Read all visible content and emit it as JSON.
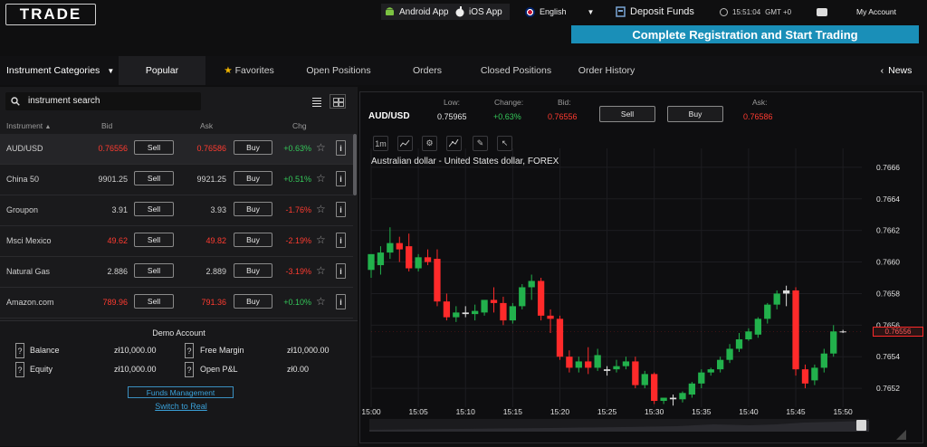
{
  "header": {
    "logo_text": "TRADE",
    "android_app": "Android App",
    "ios_app": "iOS App",
    "language": "English",
    "deposit": "Deposit Funds",
    "clock": "15:51:04",
    "timezone": "GMT +0",
    "account": "My Account",
    "register_btn": "Complete Registration and Start Trading"
  },
  "tabs": {
    "categories": "Instrument Categories",
    "popular": "Popular",
    "favorites": "Favorites",
    "open_positions": "Open Positions",
    "orders": "Orders",
    "closed_positions": "Closed Positions",
    "order_history": "Order History",
    "news": "News"
  },
  "search": {
    "value": "instrument search"
  },
  "columns": {
    "instrument": "Instrument",
    "bid": "Bid",
    "ask": "Ask",
    "chg": "Chg"
  },
  "instruments": [
    {
      "name": "AUD/USD",
      "bid": "0.76556",
      "ask": "0.76586",
      "chg": "+0.63%",
      "bid_color": "red",
      "ask_color": "red",
      "chg_color": "green"
    },
    {
      "name": "China 50",
      "bid": "9901.25",
      "ask": "9921.25",
      "chg": "+0.51%",
      "bid_color": "white",
      "ask_color": "white",
      "chg_color": "green"
    },
    {
      "name": "Groupon",
      "bid": "3.91",
      "ask": "3.93",
      "chg": "-1.76%",
      "bid_color": "white",
      "ask_color": "white",
      "chg_color": "red"
    },
    {
      "name": "Msci Mexico",
      "bid": "49.62",
      "ask": "49.82",
      "chg": "-2.19%",
      "bid_color": "red",
      "ask_color": "red",
      "chg_color": "red"
    },
    {
      "name": "Natural Gas",
      "bid": "2.886",
      "ask": "2.889",
      "chg": "-3.19%",
      "bid_color": "white",
      "ask_color": "white",
      "chg_color": "red"
    },
    {
      "name": "Amazon.com",
      "bid": "789.96",
      "ask": "791.36",
      "chg": "+0.10%",
      "bid_color": "red",
      "ask_color": "red",
      "chg_color": "green"
    }
  ],
  "buttons": {
    "sell": "Sell",
    "buy": "Buy"
  },
  "account": {
    "title": "Demo Account",
    "balance_label": "Balance",
    "balance": "zł10,000.00",
    "equity_label": "Equity",
    "equity": "zł10,000.00",
    "free_margin_label": "Free Margin",
    "free_margin": "zł10,000.00",
    "pnl_label": "Open P&L",
    "pnl": "zł0.00",
    "funds_btn": "Funds Management",
    "switch_link": "Switch to Real"
  },
  "quote": {
    "symbol": "AUD/USD",
    "low_label": "Low:",
    "low": "0.75965",
    "change_label": "Change:",
    "change": "+0.63%",
    "bid_label": "Bid:",
    "bid": "0.76556",
    "ask_label": "Ask:",
    "ask": "0.76586"
  },
  "chart_toolbar": {
    "interval": "1m"
  },
  "colors": {
    "up": "#22b14c",
    "down": "#ff2a2a",
    "accent": "#1a8fb8"
  },
  "chart_data": {
    "type": "candlestick",
    "title": "Australian dollar - United States dollar, FOREX",
    "x_ticks": [
      "15:00",
      "15:05",
      "15:10",
      "15:15",
      "15:20",
      "15:25",
      "15:30",
      "15:35",
      "15:40",
      "15:45",
      "15:50"
    ],
    "y_ticks": [
      "0.7666",
      "0.7664",
      "0.7662",
      "0.7660",
      "0.7658",
      "0.7656",
      "0.7654",
      "0.7652"
    ],
    "ylim": [
      0.76508,
      0.76672
    ],
    "xlim_minutes": [
      0,
      52
    ],
    "last_price": "0.76556",
    "candles": [
      {
        "t": 0,
        "o": 0.76595,
        "h": 0.76602,
        "c": 0.76605,
        "l": 0.7659
      },
      {
        "t": 1,
        "o": 0.76598,
        "h": 0.7661,
        "c": 0.76606,
        "l": 0.76592
      },
      {
        "t": 2,
        "o": 0.76606,
        "h": 0.76622,
        "c": 0.76612,
        "l": 0.76602
      },
      {
        "t": 3,
        "o": 0.76612,
        "h": 0.76616,
        "c": 0.76608,
        "l": 0.766
      },
      {
        "t": 4,
        "o": 0.7661,
        "h": 0.76618,
        "c": 0.76596,
        "l": 0.76594
      },
      {
        "t": 5,
        "o": 0.76596,
        "h": 0.76605,
        "c": 0.76603,
        "l": 0.76594
      },
      {
        "t": 6,
        "o": 0.76603,
        "h": 0.76608,
        "c": 0.766,
        "l": 0.76598
      },
      {
        "t": 7,
        "o": 0.76602,
        "h": 0.76608,
        "c": 0.76575,
        "l": 0.76572
      },
      {
        "t": 8,
        "o": 0.76575,
        "h": 0.7658,
        "c": 0.76565,
        "l": 0.76563
      },
      {
        "t": 9,
        "o": 0.76565,
        "h": 0.76572,
        "c": 0.76568,
        "l": 0.76562
      },
      {
        "t": 10,
        "o": 0.76568,
        "h": 0.76572,
        "c": 0.76567,
        "l": 0.76565
      },
      {
        "t": 11,
        "o": 0.76567,
        "h": 0.76573,
        "c": 0.76569,
        "l": 0.76563
      },
      {
        "t": 12,
        "o": 0.76568,
        "h": 0.76575,
        "c": 0.76576,
        "l": 0.76566
      },
      {
        "t": 13,
        "o": 0.76576,
        "h": 0.76584,
        "c": 0.76574,
        "l": 0.76568
      },
      {
        "t": 14,
        "o": 0.76574,
        "h": 0.76578,
        "c": 0.76563,
        "l": 0.7656
      },
      {
        "t": 15,
        "o": 0.76563,
        "h": 0.76574,
        "c": 0.76572,
        "l": 0.76561
      },
      {
        "t": 16,
        "o": 0.76572,
        "h": 0.76586,
        "c": 0.76584,
        "l": 0.7657
      },
      {
        "t": 17,
        "o": 0.76584,
        "h": 0.76592,
        "c": 0.76588,
        "l": 0.76576
      },
      {
        "t": 18,
        "o": 0.76588,
        "h": 0.7659,
        "c": 0.76566,
        "l": 0.76563
      },
      {
        "t": 19,
        "o": 0.76566,
        "h": 0.7657,
        "c": 0.76564,
        "l": 0.76555
      },
      {
        "t": 20,
        "o": 0.76564,
        "h": 0.76566,
        "c": 0.7654,
        "l": 0.76538
      },
      {
        "t": 21,
        "o": 0.7654,
        "h": 0.76544,
        "c": 0.76533,
        "l": 0.7653
      },
      {
        "t": 22,
        "o": 0.76533,
        "h": 0.7654,
        "c": 0.76537,
        "l": 0.7653
      },
      {
        "t": 23,
        "o": 0.76537,
        "h": 0.76546,
        "c": 0.76533,
        "l": 0.76529
      },
      {
        "t": 24,
        "o": 0.76533,
        "h": 0.76545,
        "c": 0.76541,
        "l": 0.76531
      },
      {
        "t": 25,
        "o": 0.76532,
        "h": 0.76534,
        "c": 0.76531,
        "l": 0.76528
      },
      {
        "t": 26,
        "o": 0.76532,
        "h": 0.76538,
        "c": 0.76534,
        "l": 0.7653
      },
      {
        "t": 27,
        "o": 0.76534,
        "h": 0.7654,
        "c": 0.76537,
        "l": 0.76532
      },
      {
        "t": 28,
        "o": 0.76537,
        "h": 0.7654,
        "c": 0.76522,
        "l": 0.7652
      },
      {
        "t": 29,
        "o": 0.76522,
        "h": 0.76531,
        "c": 0.76529,
        "l": 0.7652
      },
      {
        "t": 30,
        "o": 0.76529,
        "h": 0.7653,
        "c": 0.76512,
        "l": 0.7651
      },
      {
        "t": 31,
        "o": 0.76512,
        "h": 0.76514,
        "c": 0.76514,
        "l": 0.7651
      },
      {
        "t": 32,
        "o": 0.76514,
        "h": 0.76516,
        "c": 0.76513,
        "l": 0.76509
      },
      {
        "t": 33,
        "o": 0.76513,
        "h": 0.76518,
        "c": 0.76517,
        "l": 0.76511
      },
      {
        "t": 34,
        "o": 0.76516,
        "h": 0.76524,
        "c": 0.76523,
        "l": 0.76514
      },
      {
        "t": 35,
        "o": 0.76523,
        "h": 0.76532,
        "c": 0.7653,
        "l": 0.7652
      },
      {
        "t": 36,
        "o": 0.7653,
        "h": 0.76533,
        "c": 0.76532,
        "l": 0.76528
      },
      {
        "t": 37,
        "o": 0.76532,
        "h": 0.7654,
        "c": 0.76538,
        "l": 0.7653
      },
      {
        "t": 38,
        "o": 0.76538,
        "h": 0.76548,
        "c": 0.76545,
        "l": 0.76536
      },
      {
        "t": 39,
        "o": 0.76545,
        "h": 0.76555,
        "c": 0.76551,
        "l": 0.76543
      },
      {
        "t": 40,
        "o": 0.76551,
        "h": 0.76558,
        "c": 0.76556,
        "l": 0.7655
      },
      {
        "t": 41,
        "o": 0.76554,
        "h": 0.76565,
        "c": 0.76564,
        "l": 0.76552
      },
      {
        "t": 42,
        "o": 0.76564,
        "h": 0.76574,
        "c": 0.76573,
        "l": 0.76561
      },
      {
        "t": 43,
        "o": 0.76573,
        "h": 0.76582,
        "c": 0.7658,
        "l": 0.7657
      },
      {
        "t": 44,
        "o": 0.7658,
        "h": 0.76585,
        "c": 0.76582,
        "l": 0.76572
      },
      {
        "t": 45,
        "o": 0.76582,
        "h": 0.76584,
        "c": 0.76532,
        "l": 0.76528
      },
      {
        "t": 46,
        "o": 0.76532,
        "h": 0.76535,
        "c": 0.76523,
        "l": 0.7652
      },
      {
        "t": 47,
        "o": 0.76525,
        "h": 0.76535,
        "c": 0.76533,
        "l": 0.76522
      },
      {
        "t": 48,
        "o": 0.76533,
        "h": 0.76545,
        "c": 0.76542,
        "l": 0.7653
      },
      {
        "t": 49,
        "o": 0.76542,
        "h": 0.7656,
        "c": 0.76556,
        "l": 0.7654
      },
      {
        "t": 50,
        "o": 0.76556,
        "h": 0.76557,
        "c": 0.76556,
        "l": 0.76555
      }
    ]
  }
}
